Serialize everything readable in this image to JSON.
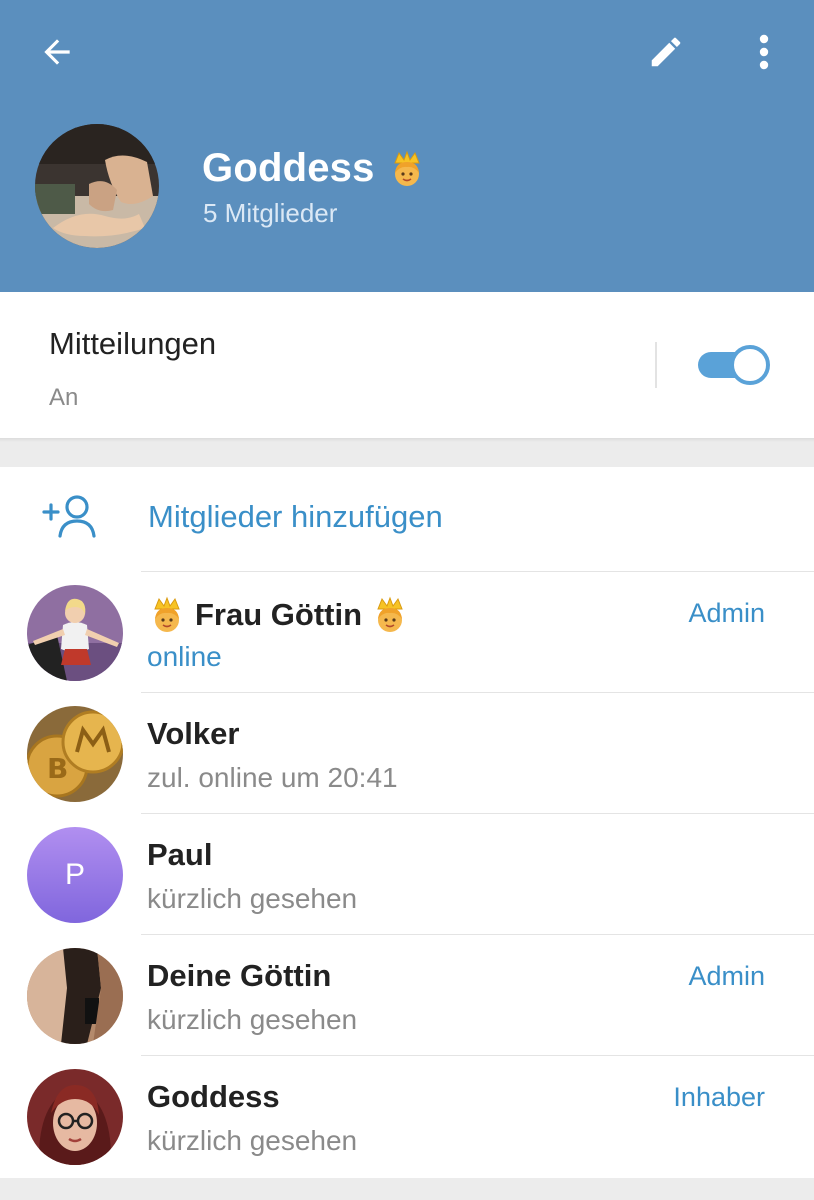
{
  "header": {
    "group_name": "Goddess",
    "member_count": "5 Mitglieder",
    "back_icon": "arrow-left-icon",
    "edit_icon": "pencil-icon",
    "more_icon": "more-vertical-icon",
    "background_color": "#5b8fbe"
  },
  "notifications": {
    "label": "Mitteilungen",
    "state": "An",
    "enabled": true
  },
  "add_members": {
    "label": "Mitglieder hinzufügen",
    "icon": "add-user-icon"
  },
  "members": [
    {
      "name": "Frau Göttin",
      "status": "online",
      "role": "Admin",
      "online": true
    },
    {
      "name": "Volker",
      "status": "zul. online um 20:41",
      "role": "",
      "online": false
    },
    {
      "name": "Paul",
      "status": "kürzlich gesehen",
      "role": "",
      "online": false,
      "initial": "P"
    },
    {
      "name": "Deine Göttin",
      "status": "kürzlich gesehen",
      "role": "Admin",
      "online": false
    },
    {
      "name": "Goddess",
      "status": "kürzlich gesehen",
      "role": "Inhaber",
      "online": false
    }
  ],
  "colors": {
    "accent": "#3a8fc8",
    "toggle": "#5aa2d8",
    "muted_text": "#8a8a8a"
  }
}
